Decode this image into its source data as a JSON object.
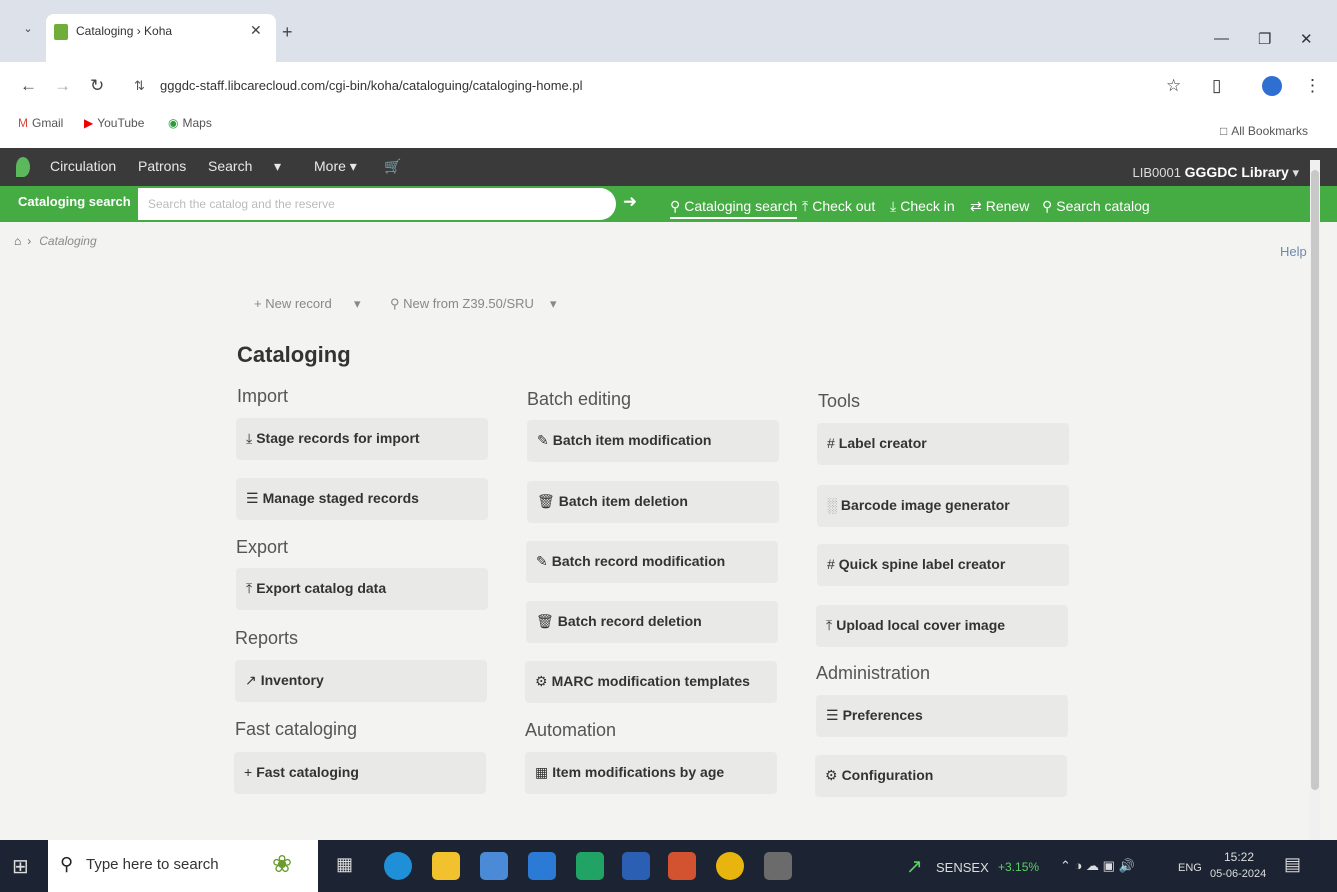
{
  "browser": {
    "tab_title": "Cataloging › Koha",
    "url": "gggdc-staff.libcarecloud.com/cgi-bin/koha/cataloguing/cataloging-home.pl",
    "bookmarks": [
      "Gmail",
      "YouTube",
      "Maps"
    ],
    "all_bookmarks": "All Bookmarks"
  },
  "koha_nav": {
    "items": [
      "Circulation",
      "Patrons",
      "Search",
      "More"
    ],
    "library_code": "LIB0001",
    "library_name": "GGGDC Library"
  },
  "searchbar": {
    "label": "Cataloging search",
    "placeholder": "Search the catalog and the reserve",
    "quick_links": [
      "Cataloging search",
      "Check out",
      "Check in",
      "Renew",
      "Search catalog"
    ]
  },
  "breadcrumb": {
    "current": "Cataloging"
  },
  "help": "Help",
  "toolbar": {
    "new_record": "New record",
    "new_z3950": "New from Z39.50/SRU"
  },
  "page_title": "Cataloging",
  "sections": {
    "import": {
      "title": "Import",
      "items": [
        "Stage records for import",
        "Manage staged records"
      ]
    },
    "export": {
      "title": "Export",
      "items": [
        "Export catalog data"
      ]
    },
    "reports": {
      "title": "Reports",
      "items": [
        "Inventory"
      ]
    },
    "fast": {
      "title": "Fast cataloging",
      "items": [
        "Fast cataloging"
      ]
    },
    "batch": {
      "title": "Batch editing",
      "items": [
        "Batch item modification",
        "Batch item deletion",
        "Batch record modification",
        "Batch record deletion",
        "MARC modification templates"
      ]
    },
    "automation": {
      "title": "Automation",
      "items": [
        "Item modifications by age"
      ]
    },
    "tools": {
      "title": "Tools",
      "items": [
        "Label creator",
        "Barcode image generator",
        "Quick spine label creator",
        "Upload local cover image"
      ]
    },
    "admin": {
      "title": "Administration",
      "items": [
        "Preferences",
        "Configuration"
      ]
    }
  },
  "taskbar": {
    "search_placeholder": "Type here to search",
    "ticker_name": "SENSEX",
    "ticker_change": "+3.15%",
    "language": "ENG",
    "time": "15:22",
    "date": "05-06-2024"
  }
}
